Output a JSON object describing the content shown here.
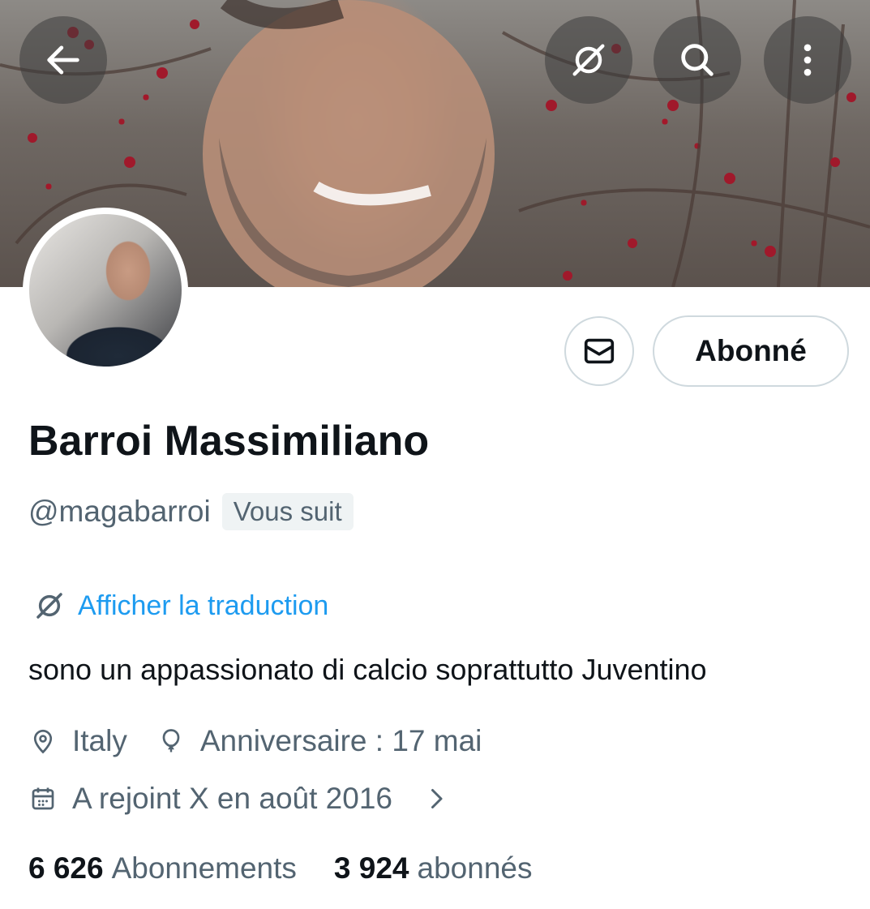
{
  "header": {
    "back_icon": "arrow-left-icon",
    "translate_icon": "translate-icon",
    "search_icon": "search-icon",
    "more_icon": "more-vertical-icon"
  },
  "profile": {
    "name": "Barroi Massimiliano",
    "handle": "@magabarroi",
    "follows_you": "Vous suit",
    "translate_label": "Afficher la traduction",
    "bio": "sono un appassionato di calcio soprattutto Juventino",
    "location": "Italy",
    "birthday": "Anniversaire : 17 mai",
    "joined": "A rejoint X en août 2016"
  },
  "actions": {
    "message_icon": "envelope-icon",
    "follow_label": "Abonné"
  },
  "stats": {
    "following_count": "6 626",
    "following_label": "Abonnements",
    "followers_count": "3 924",
    "followers_label": "abonnés"
  },
  "colors": {
    "link": "#1d9bf0",
    "secondary_text": "#536471",
    "border": "#cfd9de"
  }
}
